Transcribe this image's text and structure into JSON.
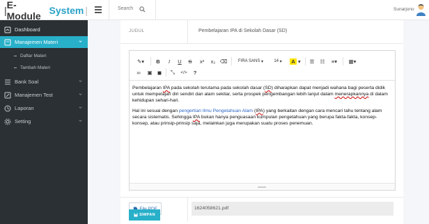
{
  "brand": {
    "part1": "E-Module",
    "part2": "System"
  },
  "topbar": {
    "search_placeholder": "Search",
    "username": "Sunarjono"
  },
  "sidebar": {
    "items": [
      {
        "label": "Dashboard",
        "icon": "home-icon"
      },
      {
        "label": "Manajemen Materi",
        "icon": "book-icon",
        "active": true
      },
      {
        "label": "Bank Soal",
        "icon": "list-icon"
      },
      {
        "label": "Manajemen Test",
        "icon": "edit-icon"
      },
      {
        "label": "Laporan",
        "icon": "clock-icon"
      },
      {
        "label": "Setting",
        "icon": "gear-icon"
      }
    ],
    "subitems": [
      "Daftar Materi",
      "Tambah Materi"
    ]
  },
  "form": {
    "judul_label": "JUDUL",
    "judul_value": "Pembelajaran IPA di Sekolah Dasar (SD)",
    "file_button": "File PDF",
    "file_value": "1624058621.pdf",
    "save_button": "SIMPAN"
  },
  "editor": {
    "font_family": "FIRA SANS",
    "font_size": "14",
    "paragraph1": {
      "a": "Pembelajaran ",
      "b": "IPA",
      "c": " pada sekolah terutama pada sekolah dasar (",
      "d": "SD",
      "e": ") diharapkan dapat menjadi wahana bagi peserta didik untuk mempelajari diri sendiri dan alam sekitar, serta prospek pengembangan lebih lanjut dalam ",
      "f": "menerapkannya",
      "g": " di dalam kehidupan sehari-hari."
    },
    "paragraph2": {
      "a": "Hal ini sesuai dengan ",
      "b": "pengertian Ilmu Pengetahuan Alam",
      "c": " (",
      "d": "IPA",
      "e": ") yang berkaitan dengan cara mencari tahu tentang alam secara sistematis. Sehingga ",
      "f": "IPA",
      "g": " bukan hanya penguasaan kumpulan pengetahuan yang berupa fakta-fakta, konsep-konsep, atau prinsip-prinsip saja, melainkan juga merupakan suatu proses penemuan."
    }
  },
  "colors": {
    "accent": "#28b0c9",
    "sidebar": "#2b3034",
    "link": "#2a64c5"
  }
}
